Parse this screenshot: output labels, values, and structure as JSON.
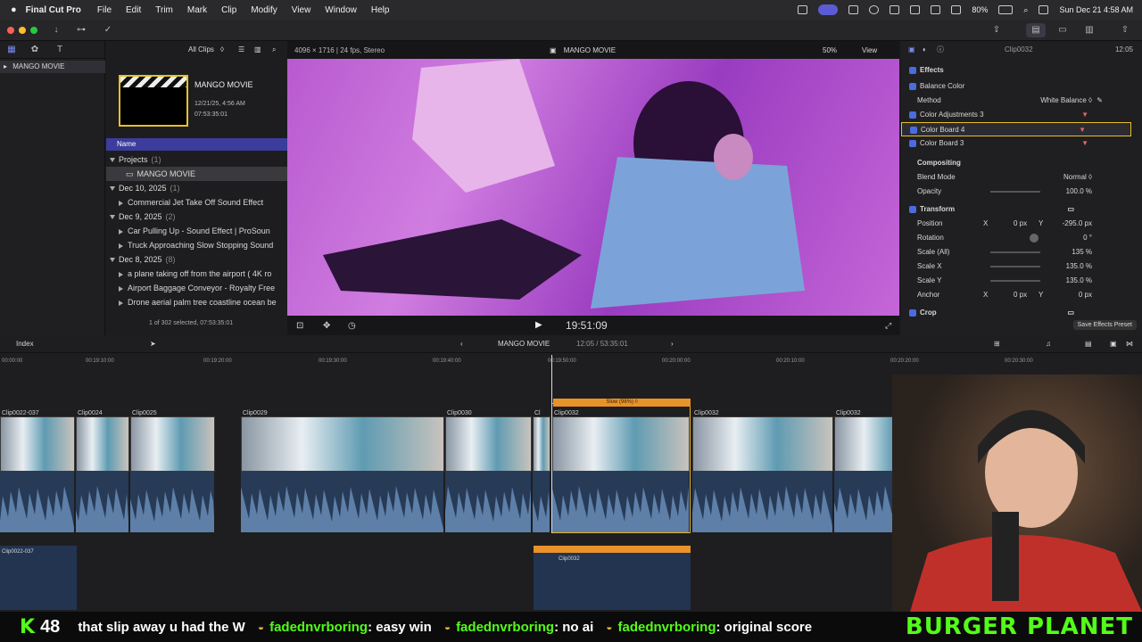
{
  "menubar": {
    "app": "Final Cut Pro",
    "items": [
      "File",
      "Edit",
      "Trim",
      "Mark",
      "Clip",
      "Modify",
      "View",
      "Window",
      "Help"
    ],
    "battery": "80%",
    "datetime": "Sun Dec 21  4:58 AM"
  },
  "library": {
    "name": "MANGO MOVIE"
  },
  "browser": {
    "filter": "All Clips",
    "project_title": "MANGO MOVIE",
    "project_date": "12/21/25, 4:56 AM",
    "project_duration": "07:53:35:01",
    "column_header": "Name",
    "status": "1 of 302 selected, 07:53:35:01",
    "rows": [
      {
        "type": "group",
        "label": "Projects",
        "count": "(1)"
      },
      {
        "type": "project",
        "label": "MANGO MOVIE"
      },
      {
        "type": "group",
        "label": "Dec 10, 2025",
        "count": "(1)"
      },
      {
        "type": "item",
        "label": "Commercial Jet Take Off Sound Effect"
      },
      {
        "type": "group",
        "label": "Dec 9, 2025",
        "count": "(2)"
      },
      {
        "type": "item",
        "label": "Car Pulling Up - Sound Effect  |  ProSoun"
      },
      {
        "type": "item",
        "label": "Truck Approaching Slow Stopping Sound"
      },
      {
        "type": "group",
        "label": "Dec 8, 2025",
        "count": "(8)"
      },
      {
        "type": "item",
        "label": "a plane taking off from the airport ( 4K ro"
      },
      {
        "type": "item",
        "label": "Airport Baggage Conveyor - Royalty Free"
      },
      {
        "type": "item",
        "label": "Drone aerial palm tree coastline ocean be"
      }
    ]
  },
  "viewer": {
    "format": "4096 × 1716 | 24 fps, Stereo",
    "title": "MANGO MOVIE",
    "zoom": "50%",
    "view": "View",
    "timecode": "19:51:09"
  },
  "inspector": {
    "clip_name": "Clip0032",
    "duration": "12:05",
    "effects_header": "Effects",
    "rows": [
      {
        "kind": "check",
        "label": "Balance Color"
      },
      {
        "kind": "param",
        "label": "Method",
        "value": "White Balance ◊"
      },
      {
        "kind": "check",
        "label": "Color Adjustments 3"
      },
      {
        "kind": "check",
        "label": "Color Board 4",
        "selected": true
      },
      {
        "kind": "check",
        "label": "Color Board 3"
      }
    ],
    "compositing": {
      "header": "Compositing",
      "blend_label": "Blend Mode",
      "blend_value": "Normal ◊",
      "opacity_label": "Opacity",
      "opacity_value": "100.0 %"
    },
    "transform": {
      "header": "Transform",
      "position_label": "Position",
      "pos_x": "0 px",
      "pos_y": "-295.0 px",
      "rotation_label": "Rotation",
      "rotation_value": "0 °",
      "scale_all_label": "Scale (All)",
      "scale_all_value": "135 %",
      "scale_x_label": "Scale X",
      "scale_x_value": "135.0 %",
      "scale_y_label": "Scale Y",
      "scale_y_value": "135.0 %",
      "anchor_label": "Anchor",
      "anchor_x": "0 px",
      "anchor_y": "0 px",
      "x": "X",
      "y": "Y"
    },
    "crop": "Crop",
    "save_preset": "Save Effects Preset"
  },
  "timeline": {
    "index": "Index",
    "project": "MANGO MOVIE",
    "duration": "12:05 / 53:35:01",
    "ruler": [
      "00:00:00",
      "00:19:10:00",
      "00:19:20:00",
      "00:19:30:00",
      "00:19:40:00",
      "00:19:50:00",
      "00:20:00:00",
      "00:20:10:00",
      "00:20:20:00",
      "00:20:30:00"
    ],
    "clips": [
      "Clip0022-037",
      "Clip0024",
      "Clip0025",
      "Clip0029",
      "Clip0030",
      "Cl",
      "Clip0032",
      "Clip0032",
      "Clip0032",
      "Clip0032"
    ],
    "speed_label": "Slow (98%) ◊",
    "lower_clip": "Clip0022-037",
    "lower_clip2": "Clip0032"
  },
  "ticker": {
    "count": "48",
    "text": "that slip away u had the W",
    "messages": [
      {
        "user": "fadednvrboring",
        "msg": ": easy win"
      },
      {
        "user": "fadednvrboring",
        "msg": ": no ai"
      },
      {
        "user": "fadednvrboring",
        "msg": ": original score"
      }
    ],
    "brand": "BURGER PLANET"
  }
}
